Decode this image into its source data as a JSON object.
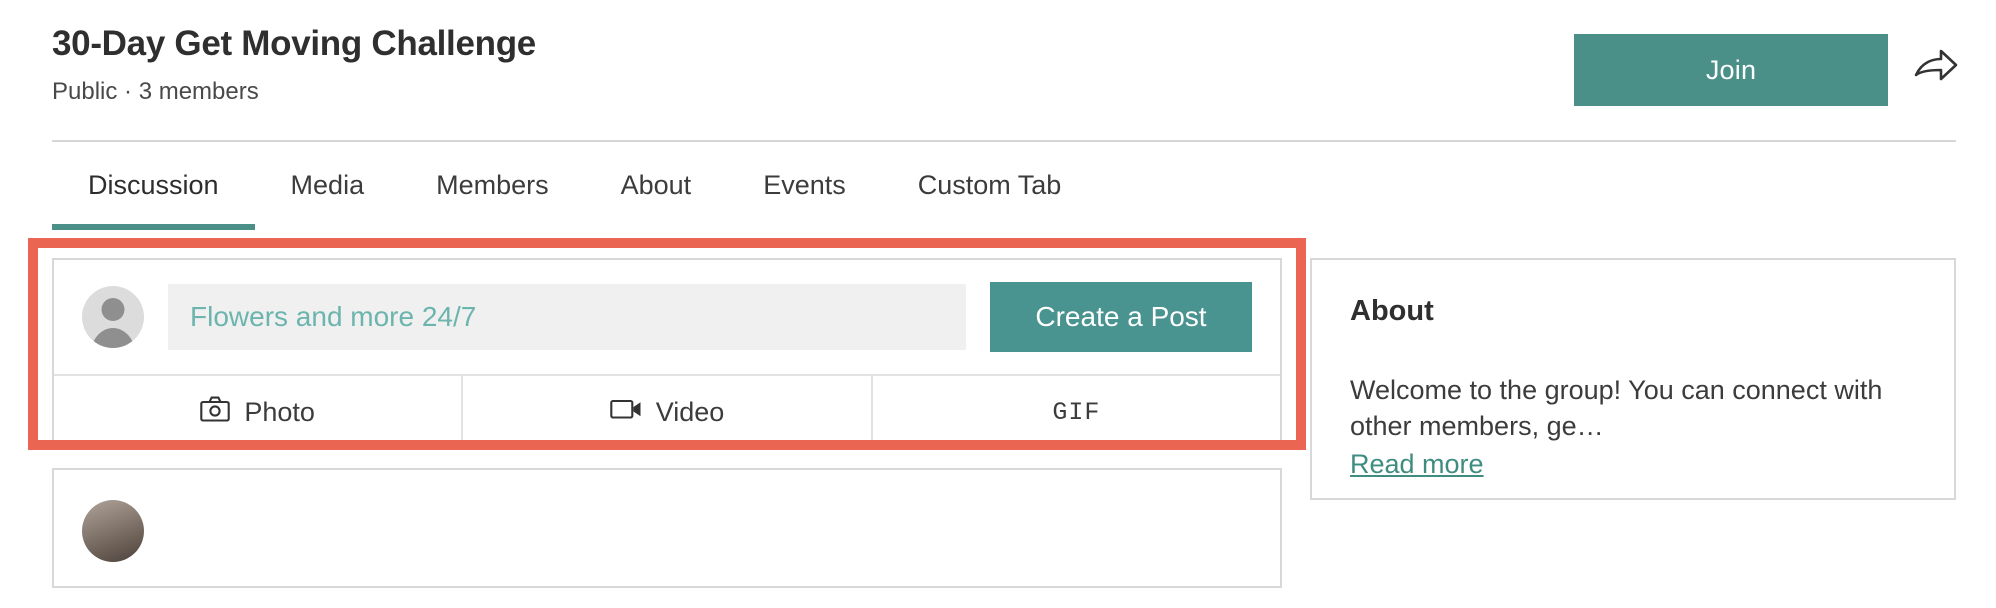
{
  "header": {
    "title": "30-Day Get Moving Challenge",
    "privacy": "Public",
    "separator": "·",
    "members": "3 members",
    "meta": "Public · 3 members",
    "join_label": "Join",
    "share_icon": "share-arrow-icon",
    "accent_color": "#4a9089"
  },
  "tabs": [
    {
      "label": "Discussion",
      "active": true
    },
    {
      "label": "Media",
      "active": false
    },
    {
      "label": "Members",
      "active": false
    },
    {
      "label": "About",
      "active": false
    },
    {
      "label": "Events",
      "active": false
    },
    {
      "label": "Custom Tab",
      "active": false
    }
  ],
  "composer": {
    "avatar_icon": "default-user-avatar-icon",
    "input_value": "",
    "input_placeholder": "Flowers and more 24/7",
    "input_text_color": "#6cb5ae",
    "input_bg_color": "#f0f0f0",
    "create_post_label": "Create a Post",
    "create_post_color": "#499390",
    "actions": [
      {
        "label": "Photo",
        "icon": "camera-icon"
      },
      {
        "label": "Video",
        "icon": "video-camera-icon"
      },
      {
        "label": "GIF",
        "icon": "gif-text-icon"
      }
    ],
    "highlight_color": "#ea6552"
  },
  "sidebar": {
    "about": {
      "title": "About",
      "body": "Welcome to the group! You can connect with other members, ge…",
      "read_more_label": "Read more",
      "link_color": "#3f8d80"
    }
  }
}
